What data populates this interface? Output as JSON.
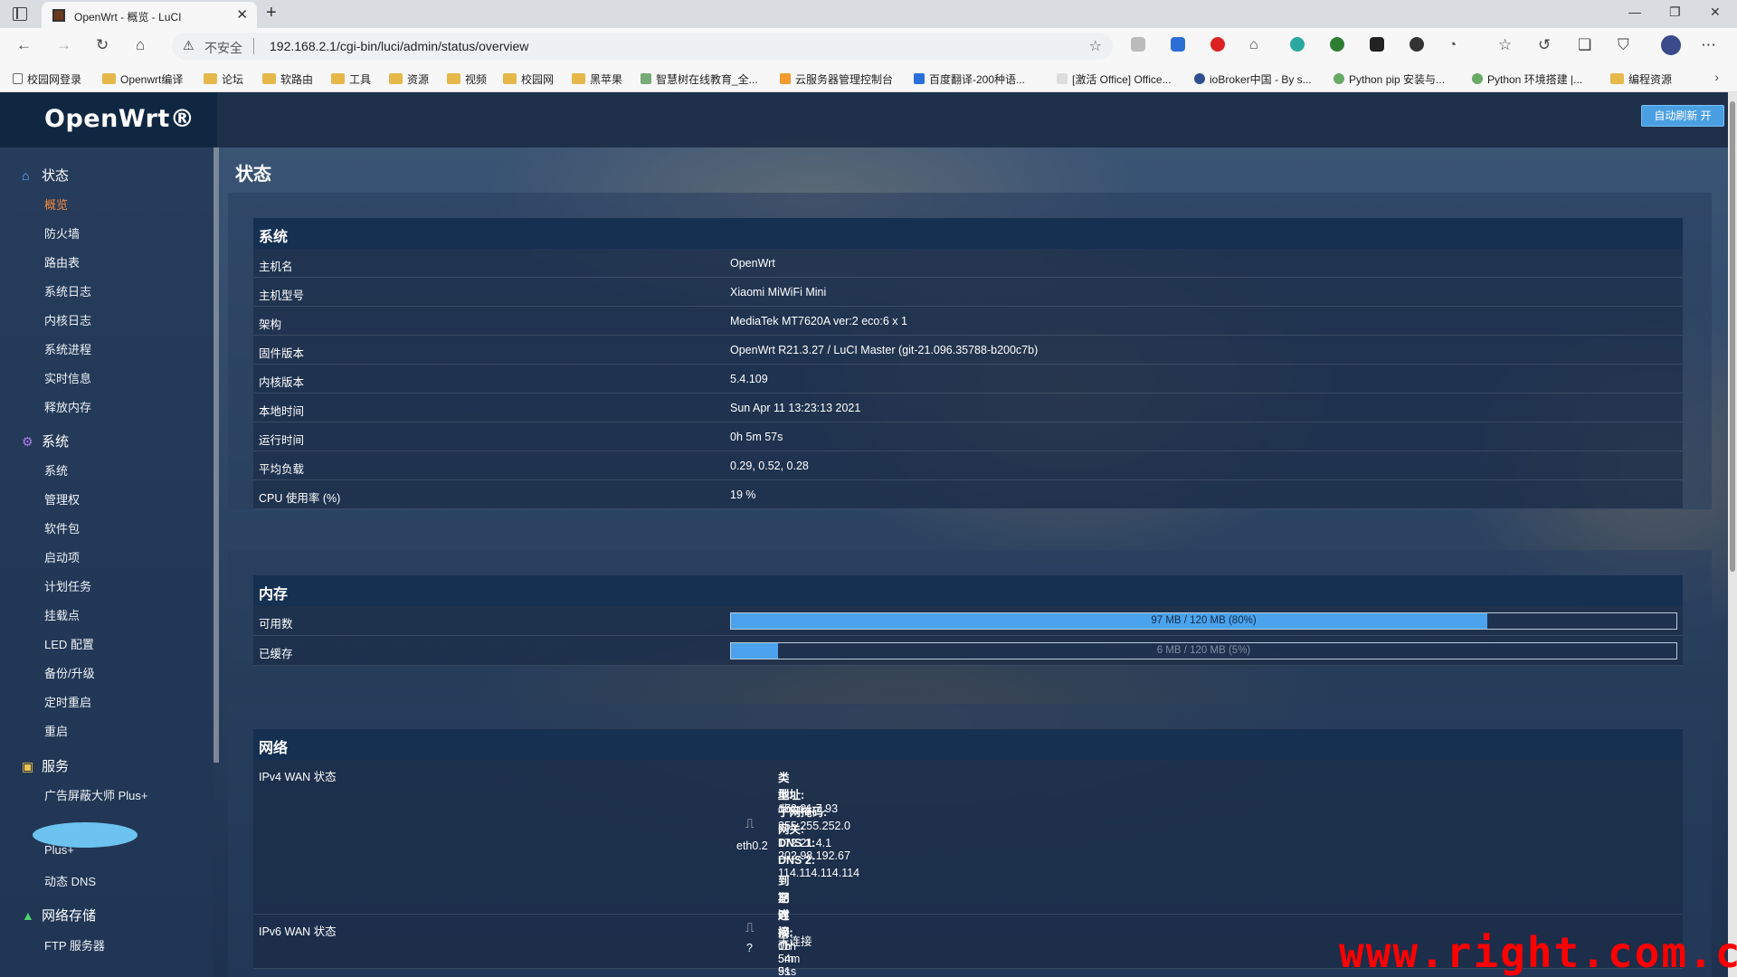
{
  "browser": {
    "tab_title": "OpenWrt - 概览 - LuCI",
    "new_tab": "+",
    "address": {
      "security_label": "不安全",
      "url": "192.168.2.1/cgi-bin/luci/admin/status/overview"
    },
    "bookmarks": [
      "校园网登录",
      "Openwrt编译",
      "论坛",
      "软路由",
      "工具",
      "资源",
      "视频",
      "校园网",
      "黑苹果",
      "智慧树在线教育_全...",
      "云服务器管理控制台",
      "百度翻译-200种语...",
      "[激活 Office] Office...",
      "ioBroker中国 - By s...",
      "Python pip 安装与...",
      "Python 环境搭建 |...",
      "编程资源"
    ]
  },
  "app": {
    "logo": "OpenWrt®",
    "refresh_button": "自动刷新 开",
    "page_title": "状态"
  },
  "sidebar": {
    "categories": [
      {
        "label": "状态",
        "icon": "home-icon",
        "items": [
          "概览",
          "防火墙",
          "路由表",
          "系统日志",
          "内核日志",
          "系统进程",
          "实时信息",
          "释放内存"
        ],
        "active": "概览"
      },
      {
        "label": "系统",
        "icon": "gear-icon",
        "items": [
          "系统",
          "管理权",
          "软件包",
          "启动项",
          "计划任务",
          "挂载点",
          "LED 配置",
          "备份/升级",
          "定时重启",
          "重启"
        ]
      },
      {
        "label": "服务",
        "icon": "services-icon",
        "items": [
          "广告屏蔽大师 Plus+",
          "Plus+",
          "动态 DNS"
        ]
      },
      {
        "label": "网络存储",
        "icon": "storage-icon",
        "items": [
          "FTP 服务器"
        ]
      }
    ]
  },
  "system": {
    "title": "系统",
    "rows": [
      {
        "k": "主机名",
        "v": "OpenWrt"
      },
      {
        "k": "主机型号",
        "v": "Xiaomi MiWiFi Mini"
      },
      {
        "k": "架构",
        "v": "MediaTek MT7620A ver:2 eco:6 x 1"
      },
      {
        "k": "固件版本",
        "v": "OpenWrt R21.3.27 / LuCI Master (git-21.096.35788-b200c7b)"
      },
      {
        "k": "内核版本",
        "v": "5.4.109"
      },
      {
        "k": "本地时间",
        "v": "Sun Apr 11 13:23:13 2021"
      },
      {
        "k": "运行时间",
        "v": "0h 5m 57s"
      },
      {
        "k": "平均负载",
        "v": "0.29, 0.52, 0.28"
      },
      {
        "k": "CPU 使用率 (%)",
        "v": "19 %"
      }
    ]
  },
  "memory": {
    "title": "内存",
    "rows": [
      {
        "k": "可用数",
        "label": "97 MB / 120 MB (80%)",
        "fraction": 0.8
      },
      {
        "k": "已缓存",
        "label": "6 MB / 120 MB (5%)",
        "fraction": 0.05
      }
    ]
  },
  "network": {
    "title": "网络",
    "ipv4_label": "IPv4 WAN 状态",
    "ipv4_device": "eth0.2",
    "ipv4_lines": [
      {
        "k": "类型:",
        "v": " dhcp"
      },
      {
        "k": "地址:",
        "v": " 172.21.7.93"
      },
      {
        "k": "子网掩码:",
        "v": " 255.255.252.0"
      },
      {
        "k": "网关:",
        "v": " 172.21.4.1"
      },
      {
        "k": "DNS 1:",
        "v": " 202.98.192.67"
      },
      {
        "k": "DNS 2:",
        "v": " 114.114.114.114"
      },
      {
        "k": "到期时间:",
        "v": " 11h 54m 51s"
      },
      {
        "k": "已连接:",
        "v": " 0h 5m 9s"
      }
    ],
    "ipv6_label": "IPv6 WAN 状态",
    "ipv6_device": "?",
    "ipv6_status": "未连接"
  },
  "watermark": "www.right.com.cn"
}
